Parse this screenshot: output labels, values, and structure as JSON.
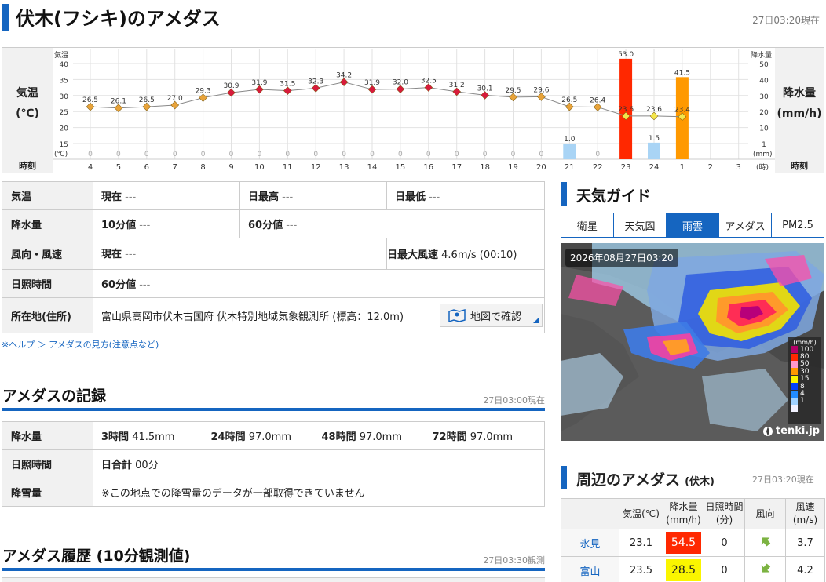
{
  "header": {
    "title": "伏木(フシキ)のアメダス",
    "timestamp": "27日03:20現在"
  },
  "chart": {
    "left_label_1": "気温",
    "left_label_2": "(℃)",
    "right_label_1": "降水量",
    "right_label_2": "(mm/h)",
    "time_label": "時刻",
    "left_axis_unit": "気温",
    "left_axis_unit_bottom": "(℃)",
    "right_axis_unit": "降水量",
    "right_axis_unit_bottom": "(mm)",
    "hour_unit": "(時)",
    "left_ticks": [
      "40",
      "35",
      "30",
      "25",
      "20",
      "15"
    ],
    "right_ticks": [
      "50",
      "40",
      "30",
      "20",
      "10",
      "1"
    ],
    "hours": [
      "4",
      "5",
      "6",
      "7",
      "8",
      "9",
      "10",
      "11",
      "12",
      "13",
      "14",
      "15",
      "16",
      "17",
      "18",
      "19",
      "20",
      "21",
      "22",
      "23",
      "24",
      "1",
      "2",
      "3"
    ]
  },
  "chart_data": {
    "type": "line",
    "x": [
      "4",
      "5",
      "6",
      "7",
      "8",
      "9",
      "10",
      "11",
      "12",
      "13",
      "14",
      "15",
      "16",
      "17",
      "18",
      "19",
      "20",
      "21",
      "22",
      "23",
      "24",
      "1"
    ],
    "series": [
      {
        "name": "気温",
        "values": [
          26.5,
          26.1,
          26.5,
          27.0,
          29.3,
          30.9,
          31.9,
          31.5,
          32.3,
          34.2,
          31.9,
          32.0,
          32.5,
          31.2,
          30.1,
          29.5,
          29.6,
          26.5,
          26.4,
          23.6,
          23.6,
          23.4
        ]
      },
      {
        "name": "降水量",
        "values": [
          0,
          0,
          0,
          0,
          0,
          0,
          0,
          0,
          0,
          0,
          0,
          0,
          0,
          0,
          0,
          0,
          0,
          1.0,
          0,
          53.0,
          1.5,
          41.5
        ]
      }
    ],
    "ylim_left": [
      15,
      40
    ],
    "ylim_right": [
      0,
      50
    ],
    "bar_colors": {
      "light": "#a9d4f5",
      "red": "#ff2800",
      "orange": "#ff9900"
    }
  },
  "info": {
    "rows": [
      {
        "label": "気温",
        "c1k": "現在",
        "c1v": "---",
        "c2k": "日最高",
        "c2v": "---",
        "c3k": "日最低",
        "c3v": "---"
      },
      {
        "label": "降水量",
        "c1k": "10分値",
        "c1v": "---",
        "c2k": "60分値",
        "c2v": "---"
      },
      {
        "label": "風向・風速",
        "c1k": "現在",
        "c1v": "---",
        "c2k": "日最大風速",
        "c2v": "4.6m/s (00:10)"
      },
      {
        "label": "日照時間",
        "c1k": "60分値",
        "c1v": "---"
      },
      {
        "label": "所在地(住所)",
        "address": "富山県高岡市伏木古国府 伏木特別地域気象観測所 (標高：12.0m)",
        "map_button": "地図で確認"
      }
    ],
    "help": "※ヘルプ ＞ アメダスの見方(注意点など)"
  },
  "records": {
    "title": "アメダスの記録",
    "timestamp": "27日03:00現在",
    "rain_label": "降水量",
    "rain": [
      {
        "k": "3時間",
        "v": "41.5mm"
      },
      {
        "k": "24時間",
        "v": "97.0mm"
      },
      {
        "k": "48時間",
        "v": "97.0mm"
      },
      {
        "k": "72時間",
        "v": "97.0mm"
      }
    ],
    "sun_label": "日照時間",
    "sun_k": "日合計",
    "sun_v": "00分",
    "snow_label": "降雪量",
    "snow_note": "※この地点での降雪量のデータが一部取得できていません"
  },
  "history": {
    "title": "アメダス履歴 (10分観測値)",
    "timestamp": "27日03:30観測"
  },
  "guide": {
    "title": "天気ガイド",
    "tabs": [
      "衛星",
      "天気図",
      "雨雲",
      "アメダス",
      "PM2.5"
    ],
    "active_tab": "雨雲",
    "radar_time": "2026年08月27日03:20",
    "legend_unit": "(mm/h)",
    "legend": [
      {
        "v": "100",
        "c": "#b40068"
      },
      {
        "v": "80",
        "c": "#ff2800"
      },
      {
        "v": "50",
        "c": "#ff99cc"
      },
      {
        "v": "30",
        "c": "#ff9900"
      },
      {
        "v": "15",
        "c": "#faf500"
      },
      {
        "v": "8",
        "c": "#0041ff"
      },
      {
        "v": "4",
        "c": "#218cff"
      },
      {
        "v": "1",
        "c": "#a0d2ff"
      },
      {
        "v": "",
        "c": "#f2f2ff"
      }
    ],
    "brand": "tenki.jp"
  },
  "nearby": {
    "title": "周辺のアメダス",
    "sub": "(伏木)",
    "timestamp": "27日03:20現在",
    "headers": [
      "",
      "気温(℃)",
      "降水量\n(mm/h)",
      "日照時間\n(分)",
      "風向",
      "風速(m/s)"
    ],
    "rows": [
      {
        "name": "氷見",
        "temp": "23.1",
        "rain": "54.5",
        "rain_color": "#ff2800",
        "sun": "0",
        "wind": "3.7"
      },
      {
        "name": "富山",
        "temp": "23.5",
        "rain": "28.5",
        "rain_color": "#faf500",
        "sun": "0",
        "wind": "4.2"
      }
    ]
  }
}
